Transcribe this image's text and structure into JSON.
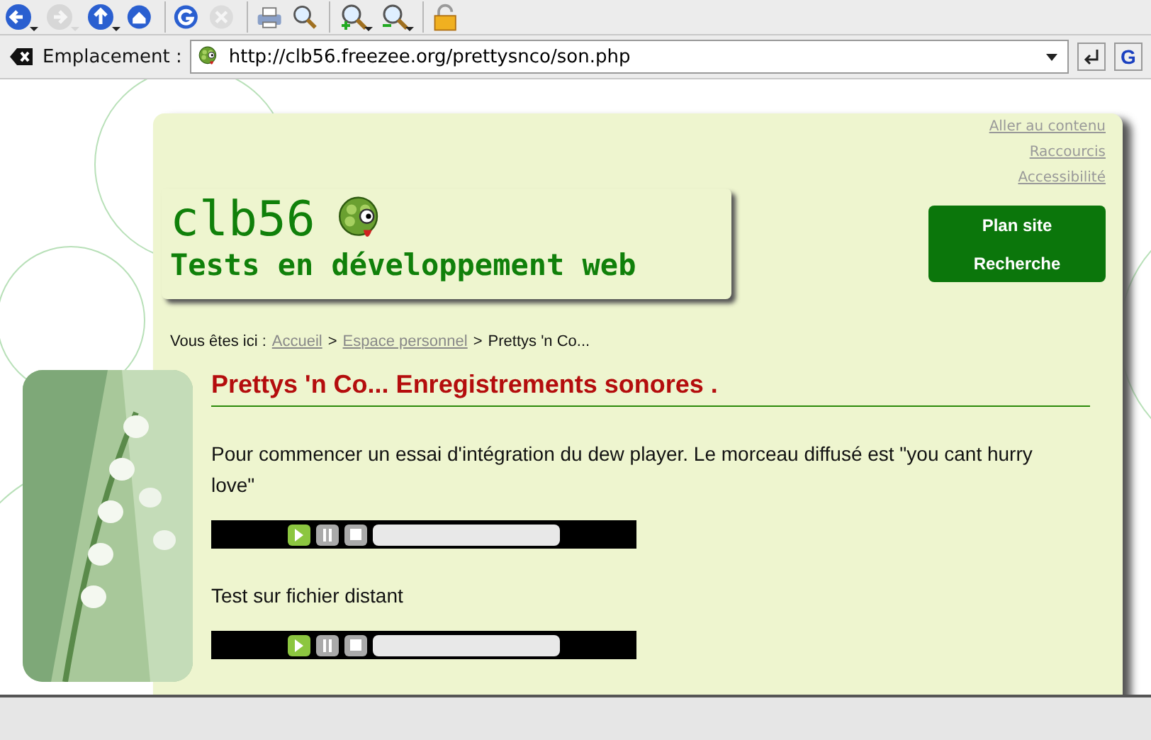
{
  "toolbar": {
    "buttons": [
      {
        "kind": "back",
        "disabled": false,
        "menu": true
      },
      {
        "kind": "forward",
        "disabled": true,
        "menu": true
      },
      {
        "kind": "up",
        "disabled": false,
        "menu": true
      },
      {
        "kind": "home",
        "disabled": false,
        "menu": false
      },
      {
        "kind": "reload",
        "disabled": false,
        "menu": false
      },
      {
        "kind": "stop",
        "disabled": true,
        "menu": false
      },
      {
        "kind": "print",
        "disabled": false,
        "menu": false
      },
      {
        "kind": "find",
        "disabled": false,
        "menu": false
      },
      {
        "kind": "zoom-in",
        "disabled": false,
        "menu": true
      },
      {
        "kind": "zoom-out",
        "disabled": false,
        "menu": true
      },
      {
        "kind": "lock",
        "disabled": false,
        "menu": false
      }
    ]
  },
  "location_bar": {
    "label": "Emplacement :",
    "url": "http://clb56.freezee.org/prettysnco/son.php",
    "search_engine": "G"
  },
  "page": {
    "skip_links": [
      "Aller au contenu",
      "Raccourcis",
      "Accessibilité"
    ],
    "logo": {
      "title": "clb56",
      "subtitle": "Tests en développement web"
    },
    "nav_buttons": [
      "Plan site",
      "Recherche"
    ],
    "breadcrumb": {
      "prefix": "Vous êtes ici :",
      "separator": ">",
      "items": [
        {
          "label": "Accueil",
          "link": true
        },
        {
          "label": "Espace personnel",
          "link": true
        },
        {
          "label": "Prettys 'n Co...",
          "link": false
        }
      ]
    },
    "heading": "Prettys 'n Co... Enregistrements sonores .",
    "content": [
      {
        "kind": "paragraph",
        "text": "Pour commencer un essai d'intégration du dew player. Le morceau diffusé est \"you cant hurry love\""
      },
      {
        "kind": "player",
        "level": 0
      },
      {
        "kind": "paragraph",
        "text": "Test sur fichier distant"
      },
      {
        "kind": "player",
        "level": 0
      }
    ]
  }
}
